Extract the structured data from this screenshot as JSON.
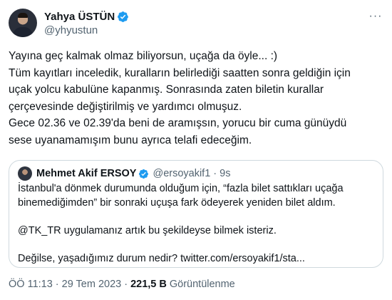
{
  "author": {
    "display_name": "Yahya ÜSTÜN",
    "handle": "@yhyustun",
    "verified_icon": "verified-badge-icon"
  },
  "tweet": {
    "lines": [
      "Yayına geç kalmak olmaz biliyorsun, uçağa da öyle... :)",
      "Tüm kayıtları inceledik, kuralların belirlediği saatten sonra geldiğin için",
      "uçak yolcu kabulüne kapanmış. Sonrasında zaten biletin kurallar",
      "çerçevesinde değiştirilmiş ve yardımcı olmuşuz.",
      "Gece 02.36 ve 02.39'da beni de aramışsın, yorucu bir cuma günüydü",
      "sese uyanamamışım bunu ayrıca telafi edeceğim."
    ]
  },
  "quote": {
    "display_name": "Mehmet Akif ERSOY",
    "handle": "@ersoyakif1",
    "dot": "·",
    "time": "9s",
    "lines": [
      "İstanbul'a dönmek durumunda olduğum için, “fazla bilet sattıkları uçağa",
      "binemediğimden” bir sonraki uçuşa fark ödeyerek yeniden bilet aldım.",
      "",
      "@TK_TR uygulamanız artık bu şekildeyse bilmek isteriz.",
      "",
      "Değilse, yaşadığımız durum nedir? twitter.com/ersoyakif1/sta..."
    ]
  },
  "meta": {
    "time": "ÖÖ 11:13",
    "dot1": "·",
    "date": "29 Tem 2023",
    "dot2": "·",
    "views_count": "221,5 B",
    "views_label": "Görüntülenme"
  },
  "menu": {
    "more_label": "···"
  },
  "colors": {
    "verified": "#1d9bf0",
    "text_primary": "#0f1419",
    "text_secondary": "#536471",
    "border": "#cfd9de"
  }
}
